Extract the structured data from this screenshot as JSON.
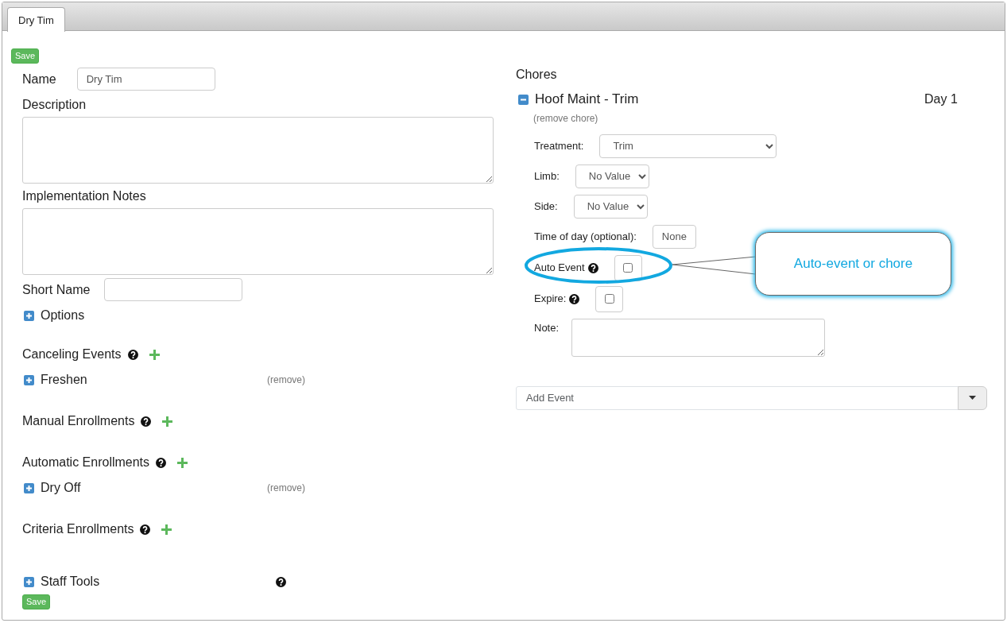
{
  "tabs": [
    {
      "label": "Dry Tim",
      "selected": true
    }
  ],
  "top_save": "Save",
  "form": {
    "name": {
      "label": "Name",
      "value": "Dry Tim"
    },
    "description": {
      "label": "Description"
    },
    "implementation_notes": {
      "label": "Implementation Notes"
    },
    "short_name": {
      "label": "Short Name"
    },
    "options": {
      "label": "Options",
      "expanded": false
    }
  },
  "sections": [
    {
      "title": "Canceling Events",
      "items": [
        {
          "label": "Freshen",
          "remove": "(remove)",
          "expanded": false
        }
      ]
    },
    {
      "title": "Manual Enrollments"
    },
    {
      "title": "Automatic Enrollments",
      "items": [
        {
          "label": "Dry Off",
          "remove": "(remove)",
          "expanded": false
        }
      ]
    },
    {
      "title": "Criteria Enrollments"
    }
  ],
  "staff_tools": {
    "label": "Staff Tools",
    "expanded": false
  },
  "bottom_save": "Save",
  "chores": {
    "title": "Chores",
    "items": [
      {
        "name": "Hoof Maint - Trim",
        "day": "Day 1",
        "expanded": true,
        "remove": "(remove chore)",
        "fields": [
          {
            "kind": "select",
            "label": "Treatment:",
            "value": "Trim"
          },
          {
            "kind": "select",
            "label": "Limb:",
            "value": "No Value"
          },
          {
            "kind": "select",
            "label": "Side:",
            "value": "No Value"
          },
          {
            "kind": "button",
            "label": "Time of day (optional):",
            "value": "None"
          },
          {
            "kind": "checkbox",
            "label": "Auto Event",
            "help": true,
            "checked": false
          },
          {
            "kind": "checkbox",
            "label": "Expire:",
            "help": true,
            "checked": false
          },
          {
            "kind": "textarea",
            "label": "Note:"
          }
        ]
      }
    ]
  },
  "add_event": {
    "placeholder": "Add Event"
  },
  "annotation": {
    "text": "Auto-event or chore"
  }
}
